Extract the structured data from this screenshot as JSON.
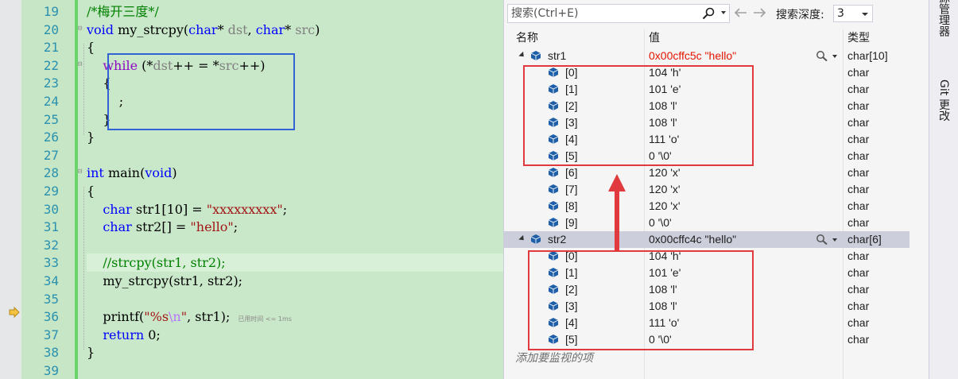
{
  "editor": {
    "lines": [
      {
        "num": "19",
        "fold": "",
        "segments": [
          {
            "t": "/*梅开三度*/",
            "c": "cm"
          }
        ]
      },
      {
        "num": "20",
        "fold": "⊟",
        "segments": [
          {
            "t": "void",
            "c": "kw"
          },
          {
            "t": " my_strcpy(",
            "c": ""
          },
          {
            "t": "char",
            "c": "kw"
          },
          {
            "t": "* ",
            "c": ""
          },
          {
            "t": "dst",
            "c": "param"
          },
          {
            "t": ", ",
            "c": ""
          },
          {
            "t": "char",
            "c": "kw"
          },
          {
            "t": "* ",
            "c": ""
          },
          {
            "t": "src",
            "c": "param"
          },
          {
            "t": ")",
            "c": ""
          }
        ]
      },
      {
        "num": "21",
        "fold": "",
        "segments": [
          {
            "t": "{",
            "c": ""
          }
        ]
      },
      {
        "num": "22",
        "fold": "⊟",
        "segments": [
          {
            "t": "    ",
            "c": ""
          },
          {
            "t": "while",
            "c": "kw2"
          },
          {
            "t": " (*",
            "c": ""
          },
          {
            "t": "dst",
            "c": "param"
          },
          {
            "t": "++ = *",
            "c": ""
          },
          {
            "t": "src",
            "c": "param"
          },
          {
            "t": "++)",
            "c": ""
          }
        ]
      },
      {
        "num": "23",
        "fold": "",
        "segments": [
          {
            "t": "    {",
            "c": ""
          }
        ]
      },
      {
        "num": "24",
        "fold": "",
        "segments": [
          {
            "t": "        ;",
            "c": ""
          }
        ]
      },
      {
        "num": "25",
        "fold": "",
        "segments": [
          {
            "t": "    }",
            "c": ""
          }
        ]
      },
      {
        "num": "26",
        "fold": "",
        "segments": [
          {
            "t": "}",
            "c": ""
          }
        ]
      },
      {
        "num": "27",
        "fold": "",
        "segments": []
      },
      {
        "num": "28",
        "fold": "⊟",
        "segments": [
          {
            "t": "int",
            "c": "kw"
          },
          {
            "t": " main(",
            "c": ""
          },
          {
            "t": "void",
            "c": "kw"
          },
          {
            "t": ")",
            "c": ""
          }
        ]
      },
      {
        "num": "29",
        "fold": "",
        "segments": [
          {
            "t": "{",
            "c": ""
          }
        ]
      },
      {
        "num": "30",
        "fold": "",
        "segments": [
          {
            "t": "    ",
            "c": ""
          },
          {
            "t": "char",
            "c": "kw"
          },
          {
            "t": " str1[10] = ",
            "c": ""
          },
          {
            "t": "\"xxxxxxxxx\"",
            "c": "str"
          },
          {
            "t": ";",
            "c": ""
          }
        ]
      },
      {
        "num": "31",
        "fold": "",
        "segments": [
          {
            "t": "    ",
            "c": ""
          },
          {
            "t": "char",
            "c": "kw"
          },
          {
            "t": " str2[] = ",
            "c": ""
          },
          {
            "t": "\"hello\"",
            "c": "str"
          },
          {
            "t": ";",
            "c": ""
          }
        ]
      },
      {
        "num": "32",
        "fold": "",
        "segments": []
      },
      {
        "num": "33",
        "fold": "",
        "current": true,
        "segments": [
          {
            "t": "    //strcpy(str1, str2);",
            "c": "cm"
          }
        ]
      },
      {
        "num": "34",
        "fold": "",
        "segments": [
          {
            "t": "    my_strcpy(str1, str2);",
            "c": ""
          }
        ]
      },
      {
        "num": "35",
        "fold": "",
        "segments": []
      },
      {
        "num": "36",
        "fold": "",
        "segments": [
          {
            "t": "    printf(",
            "c": ""
          },
          {
            "t": "\"%s",
            "c": "str"
          },
          {
            "t": "\\n",
            "c": "esc"
          },
          {
            "t": "\"",
            "c": "str"
          },
          {
            "t": ", str1);",
            "c": ""
          }
        ],
        "timing": "已用时间 <= 1ms"
      },
      {
        "num": "37",
        "fold": "",
        "segments": [
          {
            "t": "    ",
            "c": ""
          },
          {
            "t": "return",
            "c": "kw"
          },
          {
            "t": " 0;",
            "c": ""
          }
        ]
      },
      {
        "num": "38",
        "fold": "",
        "segments": [
          {
            "t": "}",
            "c": ""
          }
        ]
      },
      {
        "num": "39",
        "fold": "",
        "segments": []
      }
    ]
  },
  "watch": {
    "search_placeholder": "搜索(Ctrl+E)",
    "depth_label": "搜索深度:",
    "depth_value": "3",
    "columns": {
      "name": "名称",
      "value": "值",
      "type": "类型"
    },
    "rows": [
      {
        "name": "str1",
        "value": "0x00cffc5c \"hello\"",
        "type": "char[10]",
        "level": 0,
        "changed": true,
        "selected": false
      },
      {
        "name": "[0]",
        "value": "104 'h'",
        "type": "char",
        "level": 1
      },
      {
        "name": "[1]",
        "value": "101 'e'",
        "type": "char",
        "level": 1
      },
      {
        "name": "[2]",
        "value": "108 'l'",
        "type": "char",
        "level": 1
      },
      {
        "name": "[3]",
        "value": "108 'l'",
        "type": "char",
        "level": 1
      },
      {
        "name": "[4]",
        "value": "111 'o'",
        "type": "char",
        "level": 1
      },
      {
        "name": "[5]",
        "value": "0 '\\0'",
        "type": "char",
        "level": 1
      },
      {
        "name": "[6]",
        "value": "120 'x'",
        "type": "char",
        "level": 1
      },
      {
        "name": "[7]",
        "value": "120 'x'",
        "type": "char",
        "level": 1
      },
      {
        "name": "[8]",
        "value": "120 'x'",
        "type": "char",
        "level": 1
      },
      {
        "name": "[9]",
        "value": "0 '\\0'",
        "type": "char",
        "level": 1
      },
      {
        "name": "str2",
        "value": "0x00cffc4c \"hello\"",
        "type": "char[6]",
        "level": 0,
        "changed": false,
        "selected": true
      },
      {
        "name": "[0]",
        "value": "104 'h'",
        "type": "char",
        "level": 1
      },
      {
        "name": "[1]",
        "value": "101 'e'",
        "type": "char",
        "level": 1
      },
      {
        "name": "[2]",
        "value": "108 'l'",
        "type": "char",
        "level": 1
      },
      {
        "name": "[3]",
        "value": "108 'l'",
        "type": "char",
        "level": 1
      },
      {
        "name": "[4]",
        "value": "111 'o'",
        "type": "char",
        "level": 1
      },
      {
        "name": "[5]",
        "value": "0 '\\0'",
        "type": "char",
        "level": 1
      }
    ],
    "add_watch_text": "添加要监视的项",
    "colors": {
      "changed_value": "#e51400",
      "annotation_red": "#e0393e",
      "annotation_blue": "#3263d5",
      "icon_blue": "#1e5fa8"
    }
  },
  "sidetabs": {
    "solution_explorer": "解决方案资源管理器",
    "git_changes": "Git 更改"
  }
}
